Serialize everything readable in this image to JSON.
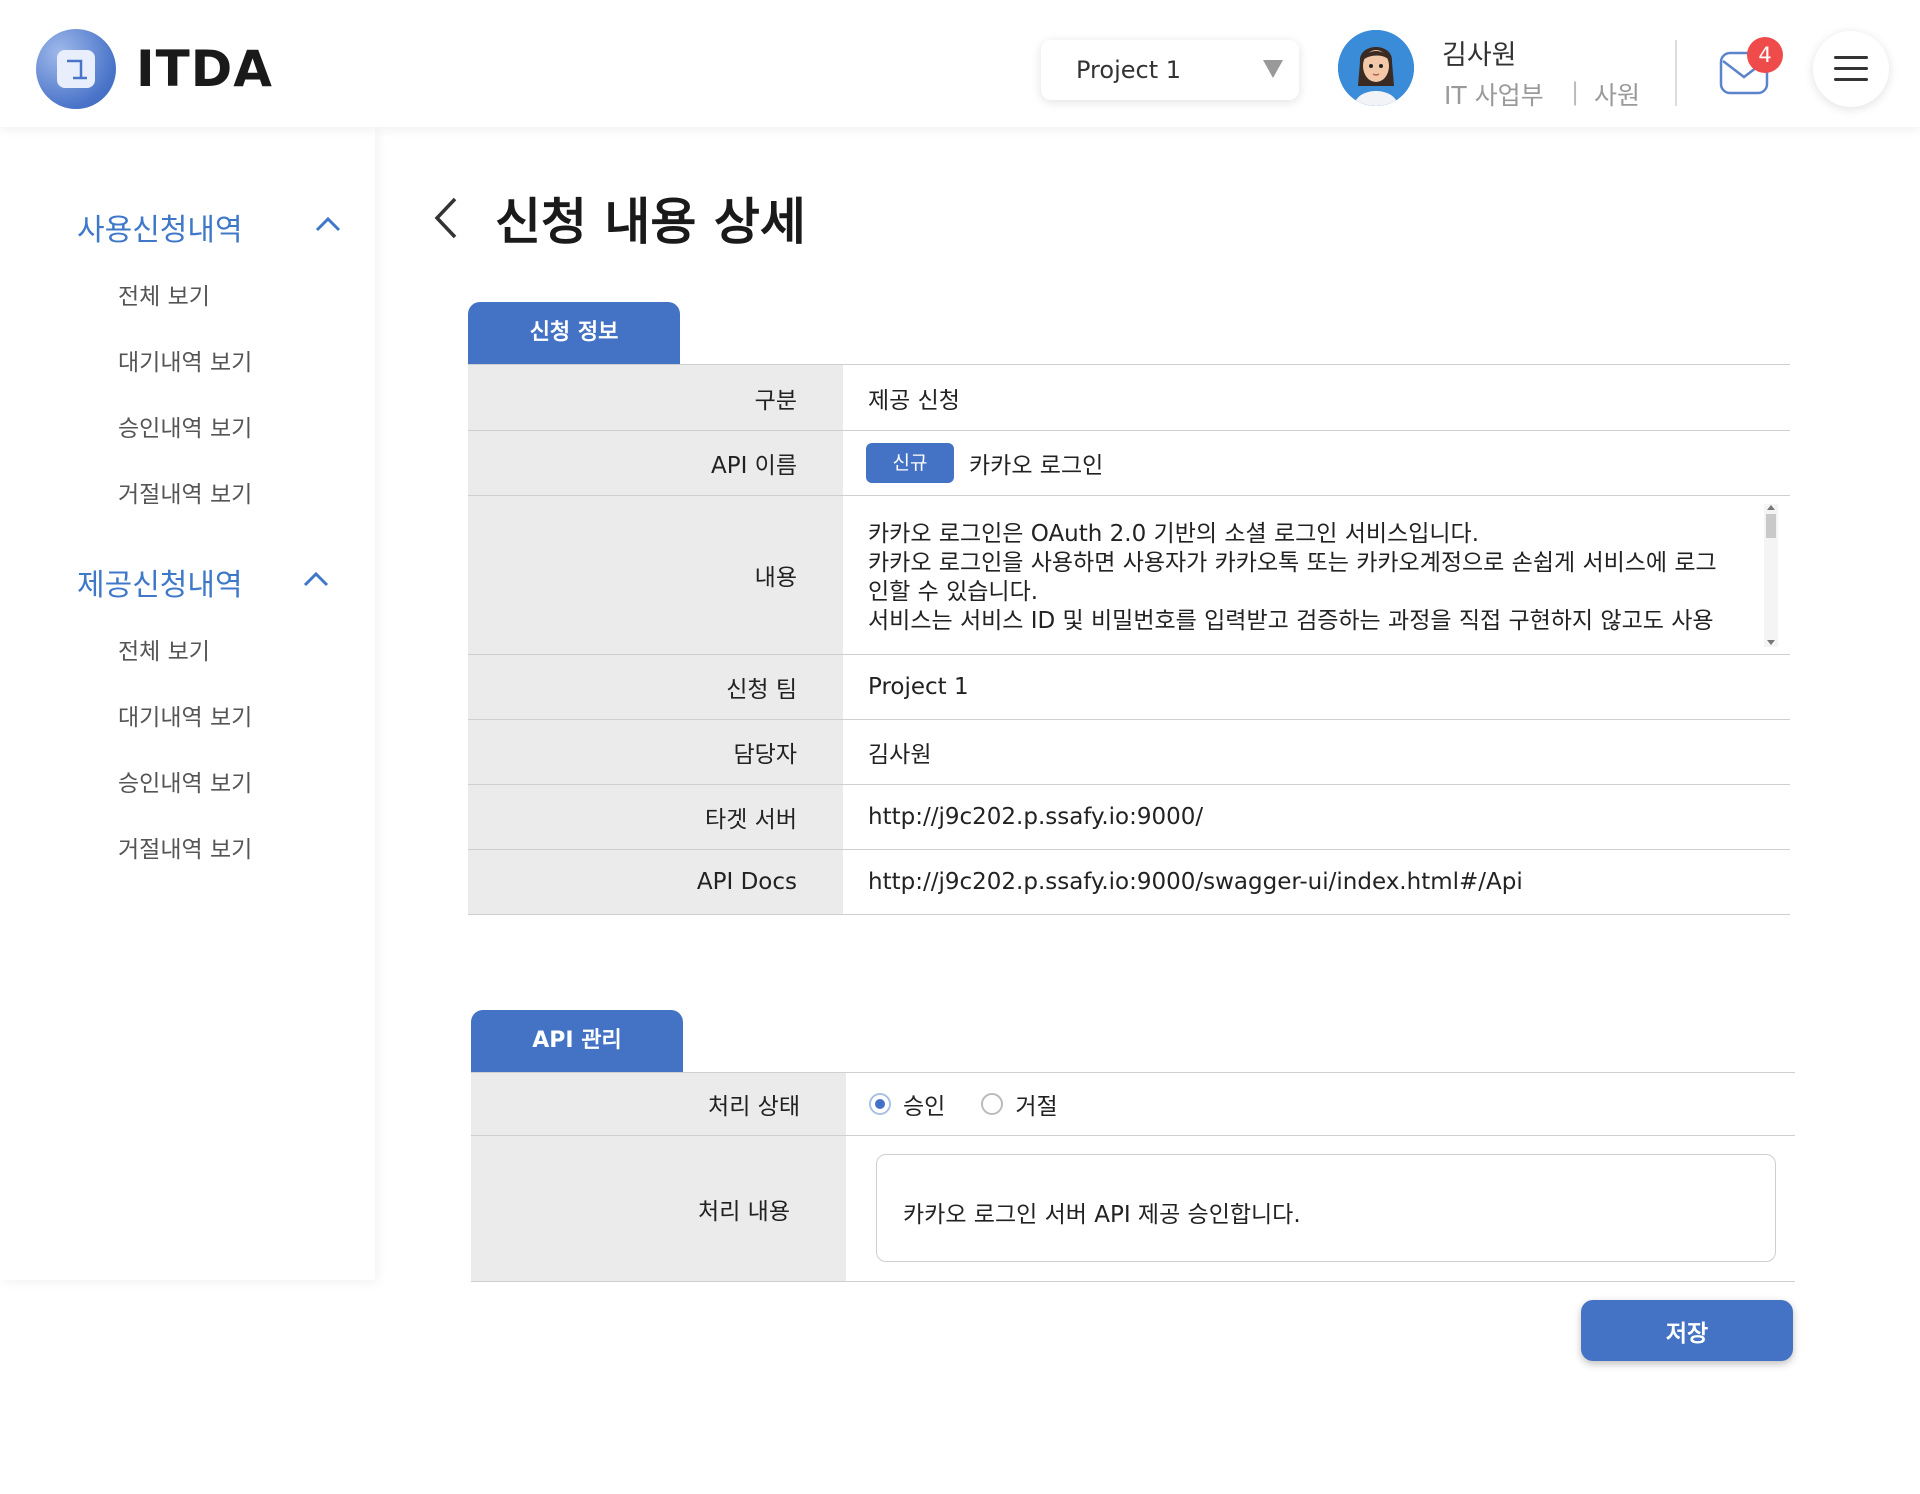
{
  "header": {
    "brand": "ITDA",
    "project_select": {
      "value": "Project 1"
    },
    "user": {
      "name": "김사원",
      "dept": "IT 사업부",
      "separator": "|",
      "rank": "사원"
    },
    "notifications": {
      "count": "4"
    }
  },
  "sidebar": {
    "groups": [
      {
        "title": "사용신청내역",
        "items": [
          "전체 보기",
          "대기내역 보기",
          "승인내역 보기",
          "거절내역 보기"
        ]
      },
      {
        "title": "제공신청내역",
        "items": [
          "전체 보기",
          "대기내역 보기",
          "승인내역 보기",
          "거절내역 보기"
        ]
      }
    ]
  },
  "page": {
    "title": "신청 내용 상세"
  },
  "info_section": {
    "tab": "신청 정보",
    "rows": {
      "category": {
        "label": "구분",
        "value": "제공 신청"
      },
      "api_name": {
        "label": "API 이름",
        "badge": "신규",
        "value": "카카오 로그인"
      },
      "content": {
        "label": "내용",
        "lines": [
          "카카오 로그인은 OAuth 2.0 기반의 소셜 로그인 서비스입니다.",
          "카카오 로그인을 사용하면 사용자가 카카오톡 또는 카카오계정으로 손쉽게 서비스에 로그",
          "인할 수 있습니다.",
          "서비스는 서비스 ID 및 비밀번호를 입력받고 검증하는 과정을 직접 구현하지 않고도 사용"
        ]
      },
      "team": {
        "label": "신청 팀",
        "value": "Project 1"
      },
      "manager": {
        "label": "담당자",
        "value": "김사원"
      },
      "target_server": {
        "label": "타겟 서버",
        "value": "http://j9c202.p.ssafy.io:9000/"
      },
      "api_docs": {
        "label": "API Docs",
        "value": "http://j9c202.p.ssafy.io:9000/swagger-ui/index.html#/Api"
      }
    }
  },
  "manage_section": {
    "tab": "API 관리",
    "status": {
      "label": "처리 상태",
      "options": [
        "승인",
        "거절"
      ],
      "selected": "승인"
    },
    "detail": {
      "label": "처리 내용",
      "value": "카카오 로그인 서버 API 제공 승인합니다."
    }
  },
  "actions": {
    "save": "저장"
  },
  "colors": {
    "accent": "#4472c4",
    "sidebar_title": "#3f78c9",
    "badge": "#f04b4b",
    "label_bg": "#ebebeb"
  }
}
